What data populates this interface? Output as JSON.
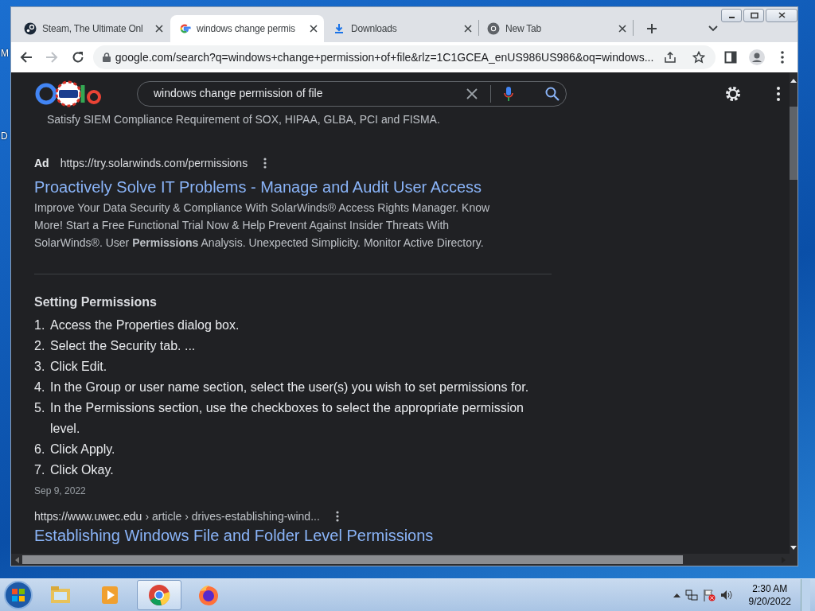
{
  "desktop_labels": [
    "M",
    "D"
  ],
  "tabs": [
    {
      "title": "Steam, The Ultimate Onl",
      "kind": "steam",
      "selected": false
    },
    {
      "title": "windows change permis",
      "kind": "google",
      "selected": true
    },
    {
      "title": "Downloads",
      "kind": "download",
      "selected": false
    },
    {
      "title": "New Tab",
      "kind": "chrome",
      "selected": false
    }
  ],
  "address": "google.com/search?q=windows+change+permission+of+file&rlz=1C1GCEA_enUS986US986&oq=windows...",
  "search": {
    "query": "windows change permission of file"
  },
  "results": [
    {
      "kind": "snippet_tail",
      "text": "Satisfy SIEM Compliance Requirement of SOX, HIPAA, GLBA, PCI and FISMA."
    },
    {
      "kind": "ad",
      "label": "Ad",
      "url": "https://try.solarwinds.com/permissions",
      "title": "Proactively Solve IT Problems - Manage and Audit User Access",
      "description": "Improve Your Data Security & Compliance With SolarWinds® Access Rights Manager. Know More! Start a Free Functional Trial Now & Help Prevent Against Insider Threats With SolarWinds®. User **Permissions** Analysis. Unexpected Simplicity. Monitor Active Directory."
    },
    {
      "kind": "featured",
      "heading": "Setting Permissions",
      "steps": [
        {
          "number": "1.",
          "text": "Access the Properties dialog box."
        },
        {
          "number": "2.",
          "text": "Select the Security tab. ..."
        },
        {
          "number": "3.",
          "text": "Click Edit."
        },
        {
          "number": "4.",
          "text": "In the Group or user name section, select the user(s) you wish to set permissions for."
        },
        {
          "number": "5.",
          "text": "In the Permissions section, use the checkboxes to select the appropriate permission level."
        },
        {
          "number": "6.",
          "text": "Click Apply."
        },
        {
          "number": "7.",
          "text": "Click Okay."
        }
      ],
      "date": "Sep 9, 2022"
    },
    {
      "kind": "organic",
      "host": "https://www.uwec.edu",
      "path": "› article › drives-establishing-wind...",
      "title": "Establishing Windows File and Folder Level Permissions"
    }
  ],
  "taskbar": {
    "apps": [
      {
        "kind": "explorer",
        "selected": false
      },
      {
        "kind": "media",
        "selected": false
      },
      {
        "kind": "chrome",
        "selected": true
      },
      {
        "kind": "firefox",
        "selected": false
      }
    ],
    "time": "2:30 AM",
    "date": "9/20/2022"
  }
}
